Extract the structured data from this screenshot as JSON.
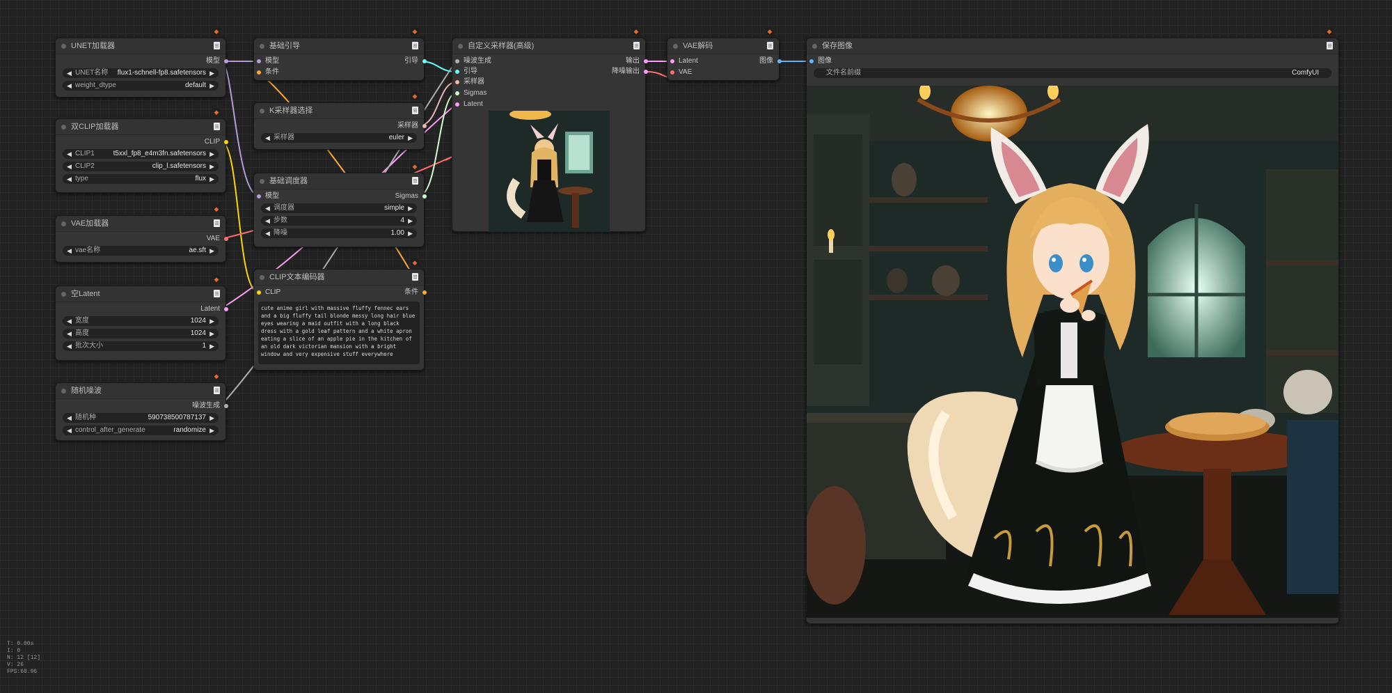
{
  "colors": {
    "model": "#b39ddb",
    "clip": "#ffd500",
    "vae": "#ff6e6e",
    "conditioning": "#ffa931",
    "latent": "#ff9cf9",
    "sigmas": "#cdffcd",
    "noise": "#b0b0b0",
    "guider": "#66ffff",
    "sampler": "#ecb4b4",
    "image": "#64b5f6"
  },
  "nodes": {
    "unet": {
      "title": "UNET加载器",
      "out_model": "模型",
      "w_unet_label": "UNET名称",
      "w_unet_value": "flux1-schnell-fp8.safetensors",
      "w_dtype_label": "weight_dtype",
      "w_dtype_value": "default"
    },
    "dualclip": {
      "title": "双CLIP加载器",
      "out_clip": "CLIP",
      "w1_label": "CLIP1",
      "w1_value": "t5xxl_fp8_e4m3fn.safetensors",
      "w2_label": "CLIP2",
      "w2_value": "clip_l.safetensors",
      "w3_label": "type",
      "w3_value": "flux"
    },
    "vaeload": {
      "title": "VAE加载器",
      "out_vae": "VAE",
      "w_label": "vae名称",
      "w_value": "ae.sft"
    },
    "latent": {
      "title": "空Latent",
      "out_latent": "Latent",
      "w1_label": "宽度",
      "w1_value": "1024",
      "w2_label": "高度",
      "w2_value": "1024",
      "w3_label": "批次大小",
      "w3_value": "1"
    },
    "noise": {
      "title": "随机噪波",
      "out_noise": "噪波生成",
      "w1_label": "随机种",
      "w1_value": "590738500787137",
      "w2_label": "control_after_generate",
      "w2_value": "randomize"
    },
    "guider": {
      "title": "基础引导",
      "in_model": "模型",
      "in_cond": "条件",
      "out_guider": "引导"
    },
    "ksel": {
      "title": "K采样器选择",
      "out_sampler": "采样器",
      "w_label": "采样器",
      "w_value": "euler"
    },
    "sched": {
      "title": "基础调度器",
      "in_model": "模型",
      "out_sigmas": "Sigmas",
      "w1_label": "调度器",
      "w1_value": "simple",
      "w2_label": "步数",
      "w2_value": "4",
      "w3_label": "降噪",
      "w3_value": "1.00"
    },
    "clipenc": {
      "title": "CLIP文本编码器",
      "in_clip": "CLIP",
      "out_cond": "条件",
      "text": "cute anime girl with massive fluffy fennec ears and a big fluffy tail blonde messy long hair blue eyes wearing a maid outfit with a long black dress with a gold leaf pattern and a white apron eating a slice of an apple pie in the kitchen of an old dark victorian mansion with a bright window and very expensive stuff everywhere"
    },
    "sampler": {
      "title": "自定义采样器(高级)",
      "in_noise": "噪波生成",
      "in_guider": "引导",
      "in_sampler": "采样器",
      "in_sigmas": "Sigmas",
      "in_latent": "Latent",
      "out_output": "输出",
      "out_denoised": "降噪输出"
    },
    "vaedec": {
      "title": "VAE解码",
      "in_latent": "Latent",
      "in_vae": "VAE",
      "out_image": "图像"
    },
    "save": {
      "title": "保存图像",
      "in_image": "图像",
      "w_label": "文件名前缀",
      "w_value": "ComfyUI"
    }
  },
  "stats": {
    "t": "T: 0.00s",
    "i": "I: 0",
    "n": "N: 12 [12]",
    "v": "V: 26",
    "fps": "FPS:60.96"
  }
}
